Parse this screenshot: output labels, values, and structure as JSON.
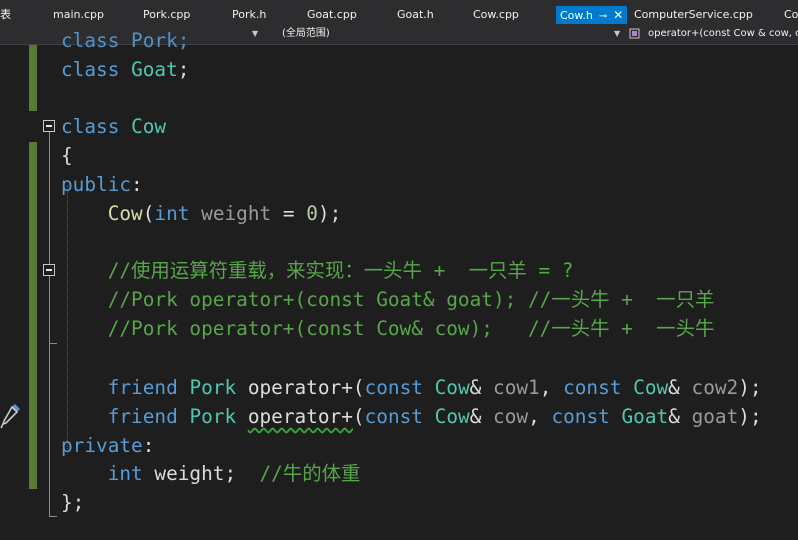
{
  "tabs": [
    {
      "label": "表"
    },
    {
      "label": "main.cpp"
    },
    {
      "label": "Pork.cpp"
    },
    {
      "label": "Pork.h"
    },
    {
      "label": "Goat.cpp"
    },
    {
      "label": "Goat.h"
    },
    {
      "label": "Cow.cpp"
    },
    {
      "label": "Cow.h",
      "pin": "⊸",
      "close": "✕"
    },
    {
      "label": "ComputerService.cpp"
    },
    {
      "label": "Co"
    }
  ],
  "nav": {
    "left_value": "",
    "scope": "(全局范围)",
    "member": "operator+(const Cow & cow, c"
  },
  "code": {
    "l0": {
      "a": "class Pork;"
    },
    "l1": {
      "a": "class",
      "b": " ",
      "c": "Goat",
      "d": ";"
    },
    "l3": {
      "a": "class",
      "b": " ",
      "c": "Cow"
    },
    "l4": {
      "a": "{"
    },
    "l5": {
      "a": "public",
      "b": ":"
    },
    "l6": {
      "a": "    ",
      "b": "Cow",
      "c": "(",
      "d": "int",
      "e": " ",
      "f": "weight",
      "g": " = ",
      "h": "0",
      "i": ");"
    },
    "l8": {
      "a": "    //使用运算符重载，来实现：一头牛 +  一只羊 = ?"
    },
    "l9": {
      "a": "    //Pork operator+(const Goat& goat); //一头牛 +  一只羊"
    },
    "l10": {
      "a": "    //Pork operator+(const Cow& cow);   //一头牛 +  一头牛"
    },
    "l12": {
      "a": "    ",
      "b": "friend",
      "c": " ",
      "d": "Pork",
      "e": " operator+(",
      "f": "const",
      "g": " ",
      "h": "Cow",
      "i": "& ",
      "j": "cow1",
      "k": ", ",
      "l": "const",
      "m": " ",
      "n": "Cow",
      "o": "& ",
      "p": "cow2",
      "q": ");"
    },
    "l13": {
      "a": "    ",
      "b": "friend",
      "c": " ",
      "d": "Pork",
      "e": " ",
      "f": "operator+",
      "g": "(",
      "h": "const",
      "i": " ",
      "j": "Cow",
      "k": "& ",
      "l": "cow",
      "m": ", ",
      "n": "const",
      "o": " ",
      "p": "Goat",
      "q": "& ",
      "r": "goat",
      "s": ");"
    },
    "l14": {
      "a": "private",
      "b": ":"
    },
    "l15": {
      "a": "    ",
      "b": "int",
      "c": " weight;  ",
      "d": "//牛的体重"
    },
    "l16": {
      "a": "};"
    }
  },
  "colors": {
    "keyword": "#569cd6",
    "type": "#4ec9b0",
    "function": "#dcdcaa",
    "parameter": "#9a9a9a",
    "number": "#b5cea8",
    "comment": "#57a64a",
    "active_tab": "#007acc",
    "change_bar": "#577a34"
  },
  "icons": {
    "gutter": "eyedropper-icon",
    "nav_member": "method-icon"
  }
}
